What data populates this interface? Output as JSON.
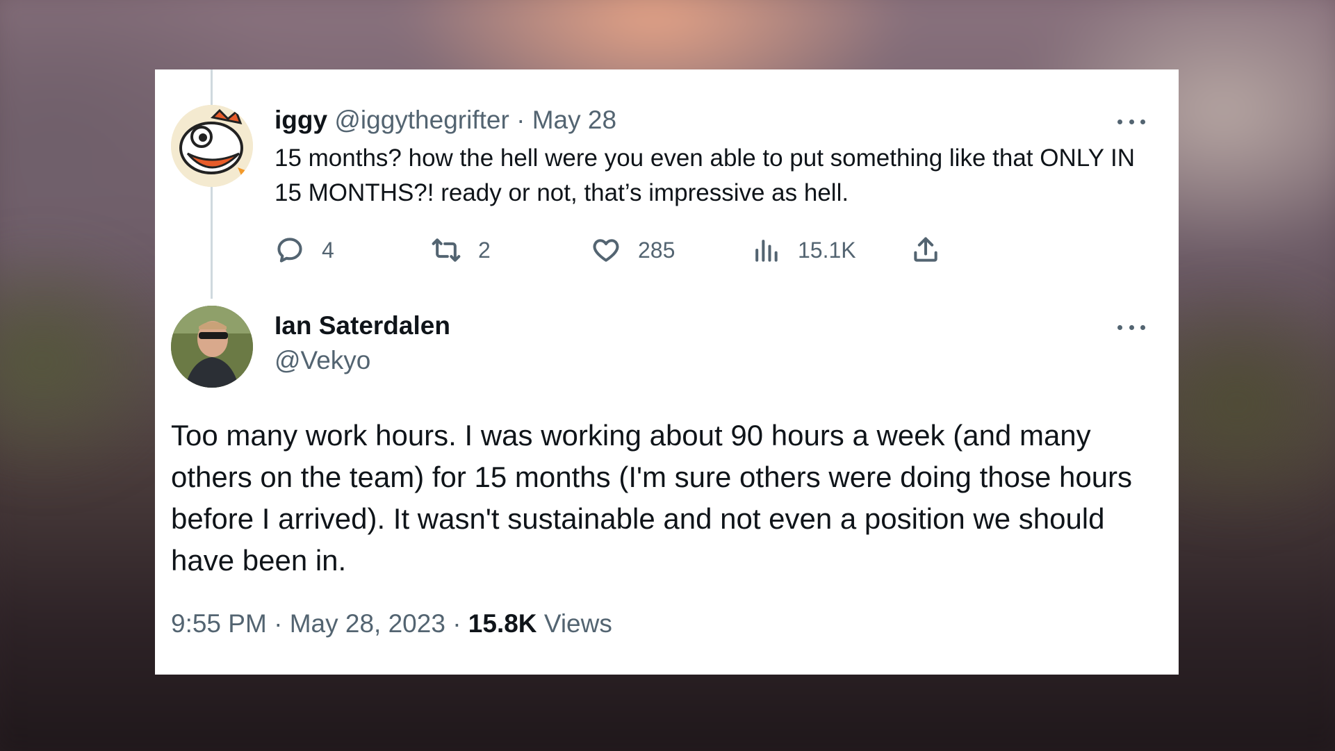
{
  "reply": {
    "name": "iggy",
    "handle": "@iggythegrifter",
    "separator": "·",
    "date": "May 28",
    "text": "15 months? how the hell were you even able to put something like that ONLY IN 15 MONTHS?! ready or not, that’s impressive as hell.",
    "stats": {
      "replies": "4",
      "retweets": "2",
      "likes": "285",
      "views": "15.1K"
    }
  },
  "main": {
    "name": "Ian Saterdalen",
    "handle": "@Vekyo",
    "text": "Too many work hours. I was working about 90 hours a week (and many others on the team) for 15 months (I'm sure others were doing those hours before I arrived). It wasn't sustainable and not even a position we should have been in.",
    "time": "9:55 PM",
    "date": "May 28, 2023",
    "separator": "·",
    "views_count": "15.8K",
    "views_label": "Views"
  },
  "icons": [
    "reply-icon",
    "retweet-icon",
    "like-icon",
    "views-icon",
    "share-icon",
    "more-icon"
  ],
  "colors": {
    "text": "#0f1419",
    "secondary": "#536471",
    "thread_line": "#cfd9de",
    "card": "#ffffff"
  }
}
